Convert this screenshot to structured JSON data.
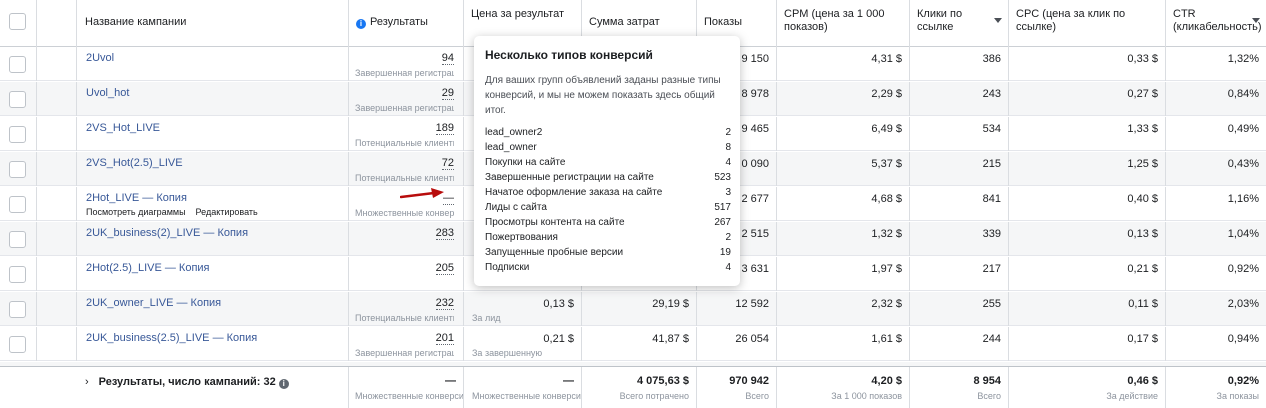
{
  "headers": {
    "name": "Название кампании",
    "results": "Результаты",
    "cost_per_result": "Цена за результат",
    "spend": "Сумма затрат",
    "impressions": "Показы",
    "cpm": "CPM (цена за 1 000 показов)",
    "clicks": "Клики по ссылке",
    "cpc": "CPC (цена за клик по ссылке)",
    "ctr": "CTR (кликабельность)"
  },
  "rows": [
    {
      "name": "2Uvol",
      "result": "94",
      "result_sub": "Завершенная регистрация",
      "cost": "",
      "cost_sub": "",
      "spend": "",
      "impressions": "9 150",
      "cpm": "4,31 $",
      "clicks": "386",
      "cpc": "0,33 $",
      "ctr": "1,32%",
      "on": true
    },
    {
      "name": "Uvol_hot",
      "result": "29",
      "result_sub": "Завершенная регистрация",
      "cost": "",
      "cost_sub": "",
      "spend": "",
      "impressions": "8 978",
      "cpm": "2,29 $",
      "clicks": "243",
      "cpc": "0,27 $",
      "ctr": "0,84%",
      "on": false
    },
    {
      "name": "2VS_Hot_LIVE",
      "result": "189",
      "result_sub": "Потенциальные клиенты",
      "cost": "",
      "cost_sub": "",
      "spend": "",
      "impressions": "9 465",
      "cpm": "6,49 $",
      "clicks": "534",
      "cpc": "1,33 $",
      "ctr": "0,49%",
      "on": false
    },
    {
      "name": "2VS_Hot(2.5)_LIVE",
      "result": "72",
      "result_sub": "Потенциальные клиенты",
      "cost": "",
      "cost_sub": "",
      "spend": "",
      "impressions": "0 090",
      "cpm": "5,37 $",
      "clicks": "215",
      "cpc": "1,25 $",
      "ctr": "0,43%",
      "on": false
    },
    {
      "name": "2Hot_LIVE — Копия",
      "result": "—",
      "result_sub": "Множественные конверсии",
      "cost": "",
      "cost_sub": "",
      "spend": "",
      "impressions": "2 677",
      "cpm": "4,68 $",
      "clicks": "841",
      "cpc": "0,40 $",
      "ctr": "1,16%",
      "on": false,
      "actions": [
        "Посмотреть диаграммы",
        "Редактировать"
      ]
    },
    {
      "name": "2UK_business(2)_LIVE — Копия",
      "result": "283",
      "result_sub": "",
      "cost": "",
      "cost_sub": "",
      "spend": "",
      "impressions": "2 515",
      "cpm": "1,32 $",
      "clicks": "339",
      "cpc": "0,13 $",
      "ctr": "1,04%",
      "on": false
    },
    {
      "name": "2Hot(2.5)_LIVE — Копия",
      "result": "205",
      "result_sub": "",
      "cost": "",
      "cost_sub": "",
      "spend": "",
      "impressions": "3 631",
      "cpm": "1,97 $",
      "clicks": "217",
      "cpc": "0,21 $",
      "ctr": "0,92%",
      "on": false
    },
    {
      "name": "2UK_owner_LIVE — Копия",
      "result": "232",
      "result_sub": "Потенциальные клиенты",
      "cost": "0,13 $",
      "cost_sub": "За лид",
      "spend": "29,19 $",
      "impressions": "12 592",
      "cpm": "2,32 $",
      "clicks": "255",
      "cpc": "0,11 $",
      "ctr": "2,03%",
      "on": false
    },
    {
      "name": "2UK_business(2.5)_LIVE — Копия",
      "result": "201",
      "result_sub": "Завершенная регистрация",
      "cost": "0,21 $",
      "cost_sub": "За завершенную регистрацию",
      "spend": "41,87 $",
      "impressions": "26 054",
      "cpm": "1,61 $",
      "clicks": "244",
      "cpc": "0,17 $",
      "ctr": "0,94%",
      "on": false
    }
  ],
  "footer": {
    "summary": "Результаты, число кампаний: 32",
    "result": "—",
    "result_sub": "Множественные конверсии",
    "cost": "—",
    "cost_sub": "Множественные конверсии",
    "spend": "4 075,63 $",
    "spend_sub": "Всего потрачено",
    "impressions": "970 942",
    "impressions_sub": "Всего",
    "cpm": "4,20 $",
    "cpm_sub": "За 1 000 показов",
    "clicks": "8 954",
    "clicks_sub": "Всего",
    "cpc": "0,46 $",
    "cpc_sub": "За действие",
    "ctr": "0,92%",
    "ctr_sub": "За показы"
  },
  "tooltip": {
    "title": "Несколько типов конверсий",
    "description": "Для ваших групп объявлений заданы разные типы конверсий, и мы не можем показать здесь общий итог.",
    "items": [
      {
        "label": "lead_owner2",
        "value": "2"
      },
      {
        "label": "lead_owner",
        "value": "8"
      },
      {
        "label": "Покупки на сайте",
        "value": "4"
      },
      {
        "label": "Завершенные регистрации на сайте",
        "value": "523"
      },
      {
        "label": "Начатое оформление заказа на сайте",
        "value": "3"
      },
      {
        "label": "Лиды с сайта",
        "value": "517"
      },
      {
        "label": "Просмотры контента на сайте",
        "value": "267"
      },
      {
        "label": "Пожертвования",
        "value": "2"
      },
      {
        "label": "Запущенные пробные версии",
        "value": "19"
      },
      {
        "label": "Подписки",
        "value": "4"
      }
    ]
  },
  "colors": {
    "link": "#385898",
    "accent": "#1877f2",
    "arrow": "#b80c0c"
  }
}
